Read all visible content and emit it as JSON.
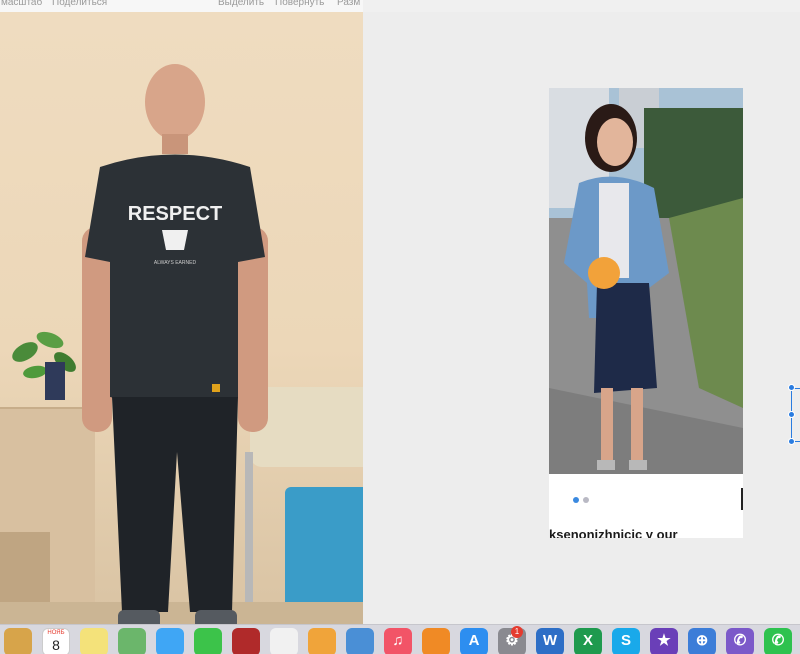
{
  "toolbar": {
    "left_items": [
      "масштаб",
      "Поделиться"
    ],
    "right_items": [
      "Выделить",
      "Повернуть",
      "Разм"
    ]
  },
  "left_photo": {
    "shirt_text": "RESPECT",
    "shirt_subtext": "ALWAYS EARNED"
  },
  "card": {
    "caption": "ksenonizhnicic y our",
    "page_dots": 2,
    "active_dot": 0
  },
  "dock": {
    "calendar_month": "НОЯБ",
    "calendar_day": "8",
    "store_badge": "1",
    "items": [
      {
        "name": "finder-icon",
        "color": "#d7a44a",
        "glyph": ""
      },
      {
        "name": "calendar-icon",
        "color": "#ffffff",
        "glyph": ""
      },
      {
        "name": "notes-icon",
        "color": "#f4e27a",
        "glyph": ""
      },
      {
        "name": "maps-icon",
        "color": "#6bb66b",
        "glyph": ""
      },
      {
        "name": "messages-icon",
        "color": "#3fa6f5",
        "glyph": ""
      },
      {
        "name": "facetime-icon",
        "color": "#3cc34a",
        "glyph": ""
      },
      {
        "name": "photo-booth-icon",
        "color": "#b02a2a",
        "glyph": ""
      },
      {
        "name": "photos-icon",
        "color": "#f1f1f1",
        "glyph": ""
      },
      {
        "name": "pages-icon",
        "color": "#f0a43a",
        "glyph": ""
      },
      {
        "name": "keynote-icon",
        "color": "#4a8fd6",
        "glyph": ""
      },
      {
        "name": "music-icon",
        "color": "#f25467",
        "glyph": "♫"
      },
      {
        "name": "books-icon",
        "color": "#f08a25",
        "glyph": ""
      },
      {
        "name": "app-store-icon",
        "color": "#2d8ef0",
        "glyph": "A"
      },
      {
        "name": "system-preferences-icon",
        "color": "#8a8a90",
        "glyph": "⚙"
      },
      {
        "name": "word-icon",
        "color": "#2d6ec6",
        "glyph": "W"
      },
      {
        "name": "excel-icon",
        "color": "#1f9a4e",
        "glyph": "X"
      },
      {
        "name": "skype-icon",
        "color": "#19a9ea",
        "glyph": "S"
      },
      {
        "name": "imovie-icon",
        "color": "#6a3fb8",
        "glyph": "★"
      },
      {
        "name": "network-icon",
        "color": "#3c7dd8",
        "glyph": "⊕"
      },
      {
        "name": "viber-icon",
        "color": "#7b59c9",
        "glyph": "✆"
      },
      {
        "name": "whatsapp-icon",
        "color": "#2ec24f",
        "glyph": "✆"
      }
    ]
  }
}
